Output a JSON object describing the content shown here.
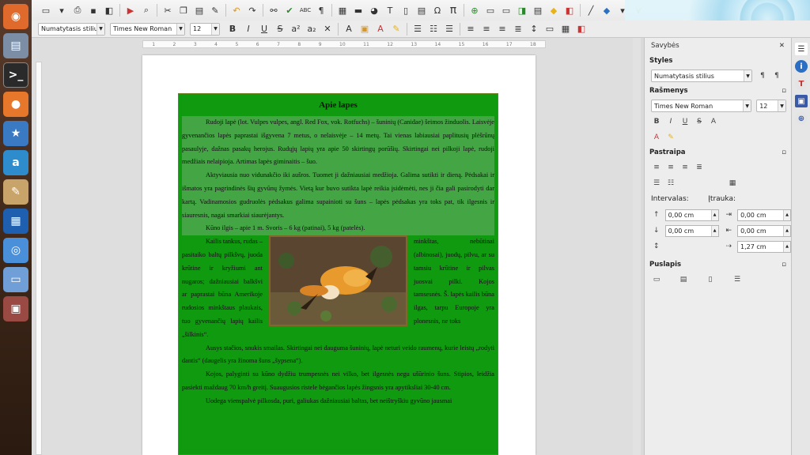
{
  "toolbar": {
    "para_style": "Numatytasis stilius",
    "font_name": "Times New Roman",
    "font_size": "12"
  },
  "ruler": {
    "ticks": [
      "1",
      "1",
      "2",
      "3",
      "4",
      "5",
      "6",
      "7",
      "8",
      "9",
      "10",
      "11",
      "12",
      "13",
      "14",
      "15",
      "16",
      "17",
      "18"
    ]
  },
  "document": {
    "title": "Apie lapes",
    "p1": "Rudoji lapė (lot. Vulpes vulpes, angl. Red Fox, vok. Rotfuchs) – šuninių (Canidae) šeimos žinduolis. Laisvėje gyvenančios lapės paprastai išgyvena 7 metus, o nelaisvėje – 14 metų. Tai vienas labiausiai paplitusių plėšrūnų pasaulyje, dažnas pasakų herojus. Rudųjų lapių yra apie 50 skirtingų porūšių. Skirtingai nei pilkoji lapė, rudoji medžiais nelaipioja. Artimas lapės giminaitis – šuo.",
    "p2": "Aktyviausia nuo vidunakčio iki aušros. Tuomet ji dažniausiai medžioja. Galima sutikti ir dieną. Pėdsakai ir išmatos yra pagrindinės šių gyvūnų žymės. Vietą kur buvo sutikta lapė reikia įsidėmėti, nes ji čia gali pasirodyti dar kartą. Vadinamosios gudruolės pėdsakus galima supainioti su šuns – lapės pėdsakas yra toks pat, tik ilgesnis ir siauresnis, nagai smarkiai siaurėjantys.",
    "p3": "Kūno ilgis – apie 1 m. Svoris – 6 kg (patinai), 5 kg (patelės).",
    "left_col": "Kailis tankus, rudas – pasitaiko baltų pilkšvų, juoda krūtine ir kryžiumi ant nugaros; dažniausiai balkšvi ar paprastai būna Amerikoje rudosios minkštaus plaukais, tuo gyvenančių lapių kailis „šilkinis“.",
    "right_col": "minkštas, nebūtinai (albinosai), juodų, pilvu, ar su tamsiu krūtine ir pilvas juosvai pilki. Kojos tamsesnės. Š. lapės kailis būna ilgas, tarpu Europoje yra plonesnis, ne toks",
    "p4": "Ausys stačios, snukis smailas. Skirtingai nei dauguma šuninių, lapė neturi veido raumenų, kurie leistų „rodyti dantis“ (daugelis yra žinoma šuns „šypsena“).",
    "p5": "Kojos, palyginti su kūno dydžiu trumpesnės nei vilko, bet ilgesnės negu ušūrinio šuns. Stipios, leidžia pasiekti maždaug 70 km/h greitį. Suaugusios ristele bėgančios lapės žingsnis yra apytiksliai 30-40 cm.",
    "p6": "Uodega vienspalvė pilkosda, puri, galiukas dažniausiai baltas, bet neištryškiu gyvūno jausmai"
  },
  "sidebar": {
    "title": "Savybės",
    "styles_header": "Styles",
    "style_value": "Numatytasis stilius",
    "char_header": "Rašmenys",
    "font_name": "Times New Roman",
    "font_size": "12",
    "para_header": "Pastraipa",
    "spacing_label": "Intervalas:",
    "indent_label": "Įtrauka:",
    "above": "0,00 cm",
    "below": "0,00 cm",
    "before": "0,00 cm",
    "after": "0,00 cm",
    "first": "1,27 cm",
    "page_header": "Puslapis"
  }
}
